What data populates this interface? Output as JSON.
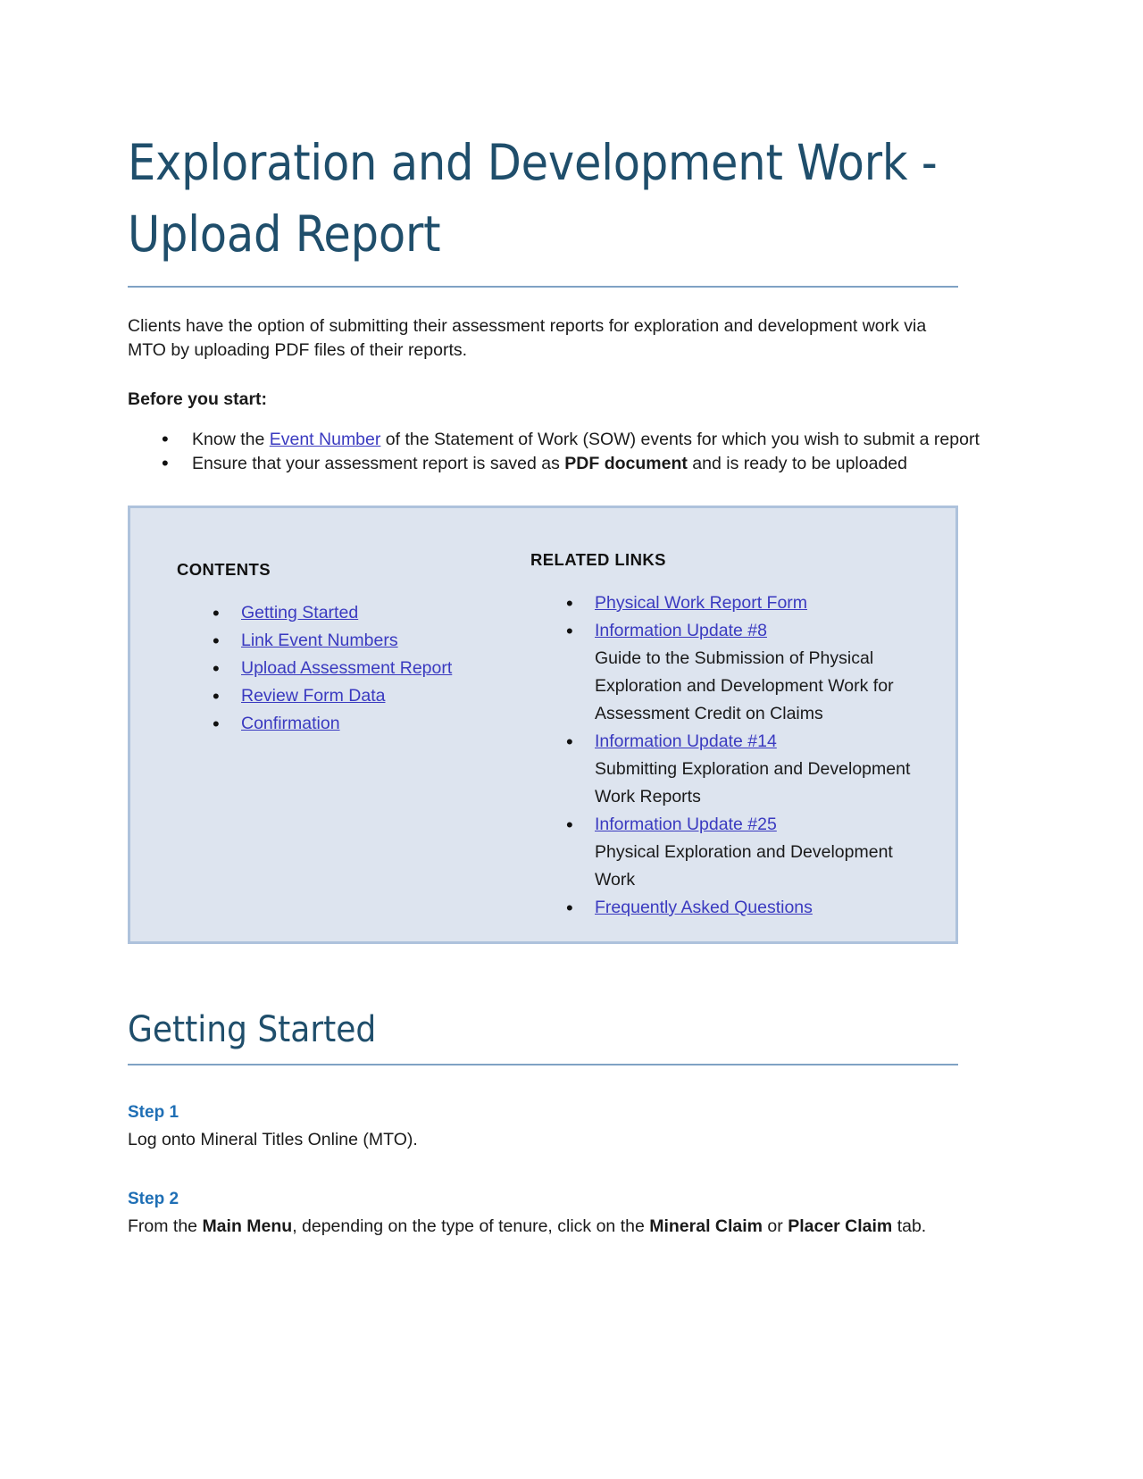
{
  "document": {
    "title": "Exploration and Development Work - Upload Report",
    "intro_paragraph": "Clients have the option of submitting their assessment reports for exploration and development work via MTO by uploading PDF files of their reports.",
    "before_you_start_label": "Before you start:",
    "prerequisites": [
      {
        "text_before_link": "Know the ",
        "link": "Event Number",
        "text_after_link": " of the Statement of Work (SOW) events for which you wish to submit a report"
      },
      {
        "text_before_bold": "Ensure that your assessment report is saved as ",
        "bold": "PDF document",
        "text_after_bold": " and is ready to be uploaded"
      }
    ]
  },
  "callout": {
    "contents": {
      "heading": "CONTENTS",
      "items": [
        {
          "label": "Getting Started"
        },
        {
          "label": "Link Event Numbers"
        },
        {
          "label": "Upload Assessment Report"
        },
        {
          "label": "Review Form Data"
        },
        {
          "label": "Confirmation"
        }
      ]
    },
    "related_links": {
      "heading": "RELATED LINKS",
      "items": [
        {
          "label": "Physical Work Report Form",
          "description": ""
        },
        {
          "label": "Information Update #8",
          "description": "Guide to the Submission of Physical Exploration and Development Work for Assessment Credit on Claims"
        },
        {
          "label": "Information Update #14",
          "description": "Submitting Exploration and Development Work Reports"
        },
        {
          "label": "Information Update #25",
          "description": "Physical Exploration and Development Work"
        },
        {
          "label": "Frequently Asked Questions",
          "description": ""
        }
      ]
    }
  },
  "getting_started": {
    "heading": "Getting Started",
    "steps": [
      {
        "label": "Step 1",
        "text": "Log onto Mineral Titles Online (MTO)."
      },
      {
        "label": "Step 2",
        "text_1": "From the ",
        "bold_1": "Main Menu",
        "text_2": ", depending on the type of tenure, click on the ",
        "bold_2": "Mineral Claim",
        "text_3": " or ",
        "bold_3": "Placer Claim",
        "text_4": " tab."
      }
    ]
  },
  "colors": {
    "heading_blue": "#1f4e6b",
    "step_blue": "#1f6fb5",
    "link_blue": "#3a3ac0",
    "callout_fill": "#dde4ef",
    "callout_border": "#aec2dc",
    "rule": "#7fa2c4"
  }
}
